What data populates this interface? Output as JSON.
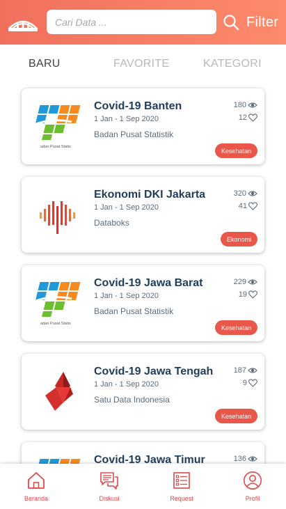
{
  "search": {
    "placeholder": "Cari Data ..."
  },
  "filter": {
    "label": "Filter"
  },
  "tabs": [
    {
      "label": "BARU",
      "active": true
    },
    {
      "label": "FAVORITE",
      "active": false
    },
    {
      "label": "KATEGORI",
      "active": false
    }
  ],
  "cards": [
    {
      "title": "Covid-19 Banten",
      "date": "1 Jan - 1 Sep 2020",
      "source": "Badan Pusat Statistik",
      "views": "180",
      "likes": "12",
      "tag": "Kesehatan",
      "logo": "bps-logo",
      "logo_caption": "adan Pusat Statis"
    },
    {
      "title": "Ekonomi DKI Jakarta",
      "date": "1 Jan - 1 Sep 2020",
      "source": "Databoks",
      "views": "320",
      "likes": "41",
      "tag": "Ekonomi",
      "logo": "databoks-logo"
    },
    {
      "title": "Covid-19 Jawa Barat",
      "date": "1 Jan - 1 Sep 2020",
      "source": "Badan Pusat Statistik",
      "views": "229",
      "likes": "19",
      "tag": "Kesehatan",
      "logo": "bps-logo",
      "logo_caption": "adan Pusat Statis"
    },
    {
      "title": "Covid-19 Jawa Tengah",
      "date": "1 Jan - 1 Sep 2020",
      "source": "Satu Data Indonesia",
      "views": "187",
      "likes": "9",
      "tag": "Kesehatan",
      "logo": "satu-data-logo"
    },
    {
      "title": "Covid-19 Jawa Timur",
      "date": "",
      "source": "",
      "views": "136",
      "likes": "",
      "tag": "",
      "logo": "bps-logo"
    }
  ],
  "nav": [
    {
      "label": "Beranda",
      "icon": "home-icon"
    },
    {
      "label": "Diskusi",
      "icon": "chat-icon"
    },
    {
      "label": "Request",
      "icon": "request-icon"
    },
    {
      "label": "Profil",
      "icon": "profile-icon"
    }
  ],
  "colors": {
    "header_start": "#f0705d",
    "header_end": "#fd8a6b",
    "accent": "#e9574b",
    "title": "#1f3d5a",
    "text": "#5b6b7a"
  }
}
